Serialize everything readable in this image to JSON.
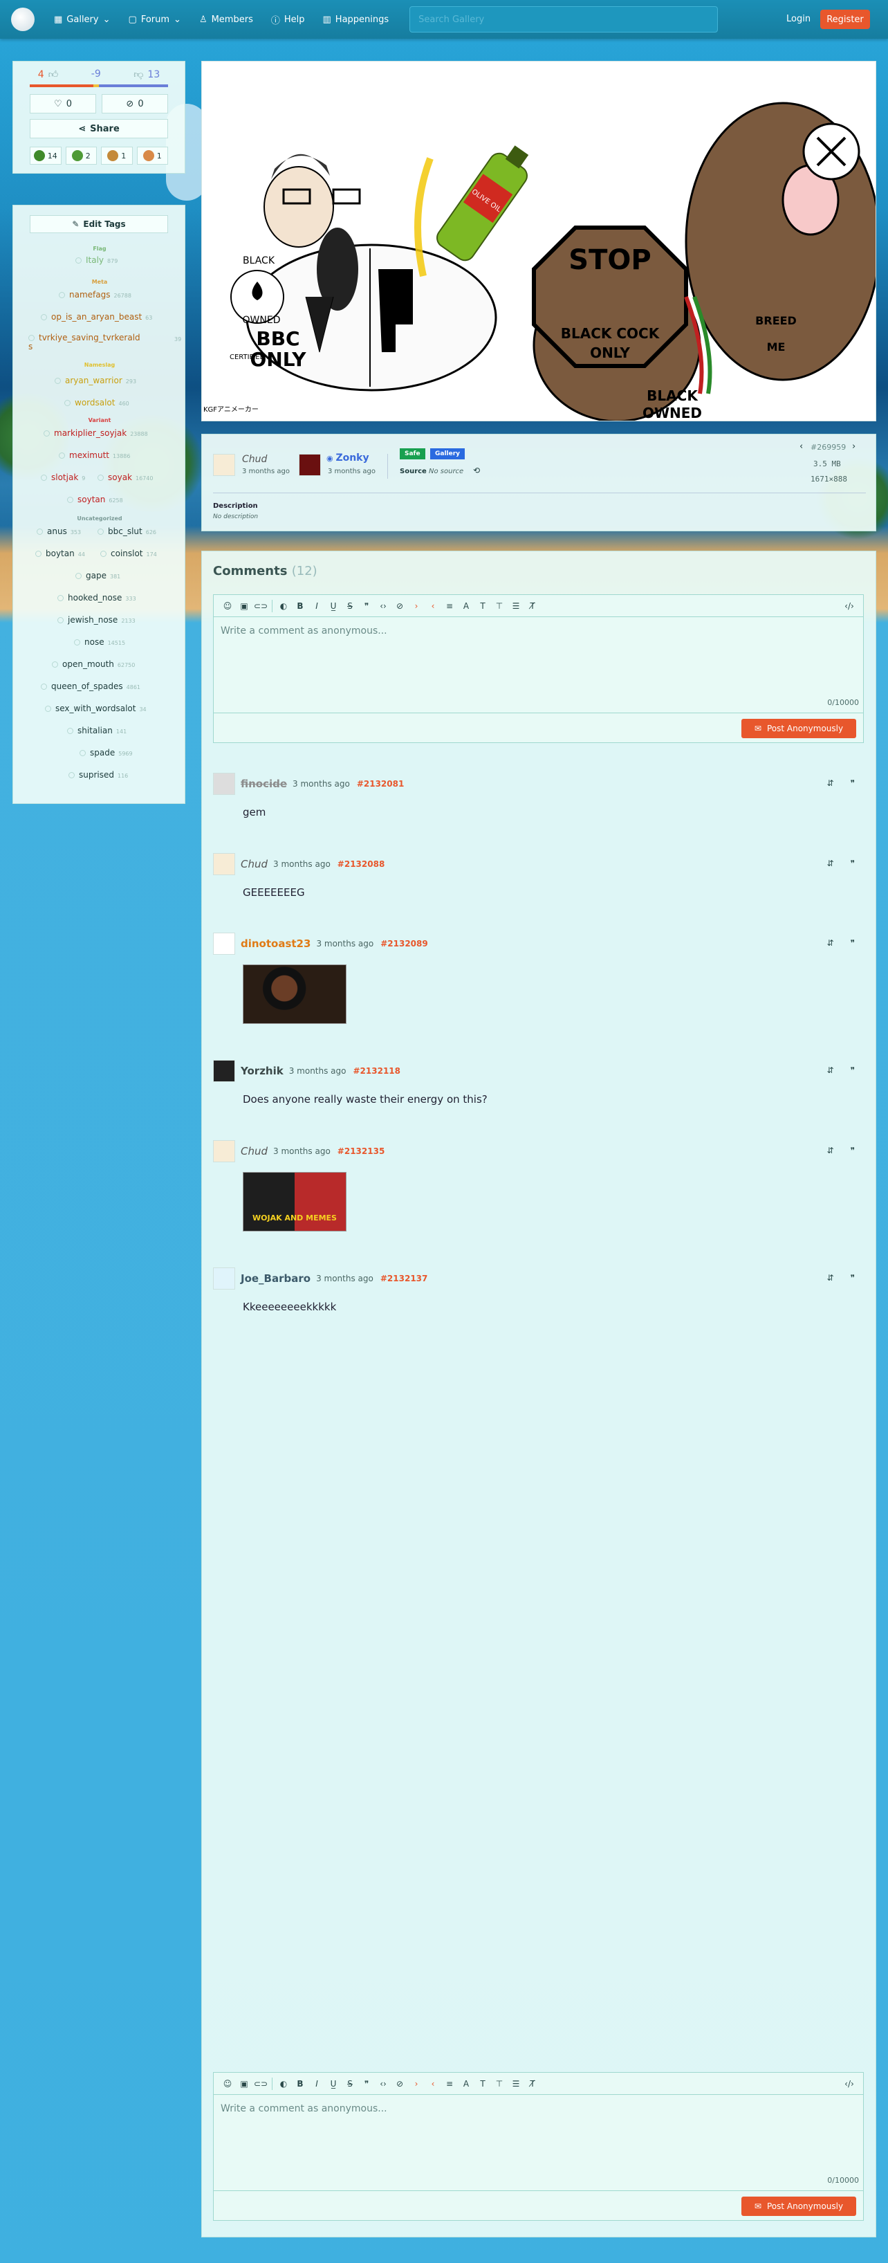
{
  "nav": {
    "gallery": "Gallery",
    "forum": "Forum",
    "members": "Members",
    "help": "Help",
    "happenings": "Happenings",
    "search_placeholder": "Search Gallery",
    "login": "Login",
    "register": "Register"
  },
  "votes": {
    "up": "4",
    "score": "-9",
    "down": "13"
  },
  "counts": {
    "fav": "0",
    "hide": "0"
  },
  "share": "Share",
  "reactions": [
    {
      "icon": "frog-icon",
      "count": "14",
      "color": "#3f8a2a"
    },
    {
      "icon": "frog-face-icon",
      "count": "2",
      "color": "#4e9a36"
    },
    {
      "icon": "wojak-icon",
      "count": "1",
      "color": "#c48a3a"
    },
    {
      "icon": "blush-icon",
      "count": "1",
      "color": "#d88a48"
    }
  ],
  "edit_tags": "Edit Tags",
  "tags": {
    "flag_cat": "Flag",
    "italy": "Italy",
    "italy_n": "879",
    "meta_cat": "Meta",
    "namefags": "namefags",
    "namefags_n": "26788",
    "op_is_an_aryan_beast": "op_is_an_aryan_beast",
    "op_n": "63",
    "tvrkiye_saving_tvrkeralds": "tvrkiye_saving_tvrkerald\ns",
    "tvrkiye_n": "39",
    "nameslag_cat": "Nameslag",
    "aryan_warrior": "aryan_warrior",
    "aryan_n": "293",
    "wordsalot": "wordsalot",
    "wordsalot_n": "460",
    "variant_cat": "Variant",
    "markiplier_soyjak": "markiplier_soyjak",
    "markiplier_n": "23888",
    "meximutt": "meximutt",
    "meximutt_n": "13886",
    "slotjak": "slotjak",
    "slotjak_n": "9",
    "soyak": "soyak",
    "soyak_n": "16740",
    "soytan": "soytan",
    "soytan_n": "6258",
    "uncat": "Uncategorized",
    "anus": "anus",
    "anus_n": "353",
    "bbc_slut": "bbc_slut",
    "bbc_slut_n": "626",
    "boytan": "boytan",
    "boytan_n": "44",
    "coinslot": "coinslot",
    "coinslot_n": "174",
    "gape": "gape",
    "gape_n": "381",
    "hooked_nose": "hooked_nose",
    "hooked_nose_n": "333",
    "jewish_nose": "jewish_nose",
    "jewish_nose_n": "2133",
    "nose": "nose",
    "nose_n": "14515",
    "open_mouth": "open_mouth",
    "open_mouth_n": "62750",
    "queen_of_spades": "queen_of_spades",
    "queen_n": "4861",
    "sex_with_wordsalot": "sex_with_wordsalot",
    "sex_n": "34",
    "shitalian": "shitalian",
    "shitalian_n": "141",
    "spade": "spade",
    "spade_n": "5969",
    "suprised": "suprised",
    "suprised_n": "116"
  },
  "image": {
    "left_text1": "BLACK",
    "left_text2": "OWNED",
    "left_text3": "BBC",
    "left_text4": "ONLY",
    "left_text5": "CERTIFIED",
    "stop1": "STOP",
    "stop2": "BLACK COCK",
    "stop3": "ONLY",
    "right_black": "BLACK",
    "right_owned": "OWNED",
    "breed1": "BREED",
    "breed2": "ME",
    "bottle": "OLIVE OIL",
    "corner": "KGFアニメーカー"
  },
  "post": {
    "uploader": "Chud",
    "uploader_time": "3 months ago",
    "approver": "Zonky",
    "approver_time": "3 months ago",
    "rating": "Safe",
    "gallery": "Gallery",
    "source_label": "Source",
    "source_value": "No source",
    "id": "#269959",
    "size": "3.5 MB",
    "dims": "1671×888",
    "desc_label": "Description",
    "desc_value": "No description"
  },
  "comments_title": "Comments",
  "comments_count": "(12)",
  "editor": {
    "placeholder": "Write a comment as anonymous...",
    "counter": "0/10000",
    "post_btn": "Post Anonymously"
  },
  "comments": [
    {
      "name": "finocide",
      "time": "3 months ago",
      "id": "#2132081",
      "text": "gem",
      "name_color": "#8c8c8c"
    },
    {
      "name": "Chud",
      "time": "3 months ago",
      "id": "#2132088",
      "text": "GEEEEEEEG",
      "name_color": "#555"
    },
    {
      "name": "dinotoast23",
      "time": "3 months ago",
      "id": "#2132089",
      "text": "",
      "name_color": "#e07b16"
    },
    {
      "name": "Yorzhik",
      "time": "3 months ago",
      "id": "#2132118",
      "text": "Does anyone really waste their energy on this?",
      "name_color": "#3c4a4a"
    },
    {
      "name": "Chud",
      "time": "3 months ago",
      "id": "#2132135",
      "text": "",
      "name_color": "#555"
    },
    {
      "name": "Joe_Barbaro",
      "time": "3 months ago",
      "id": "#2132137",
      "text": "Kkeeeeeeeekkkkk",
      "name_color": "#3c5a6a"
    }
  ],
  "thumb2_text": "WOJAK AND MEMES"
}
